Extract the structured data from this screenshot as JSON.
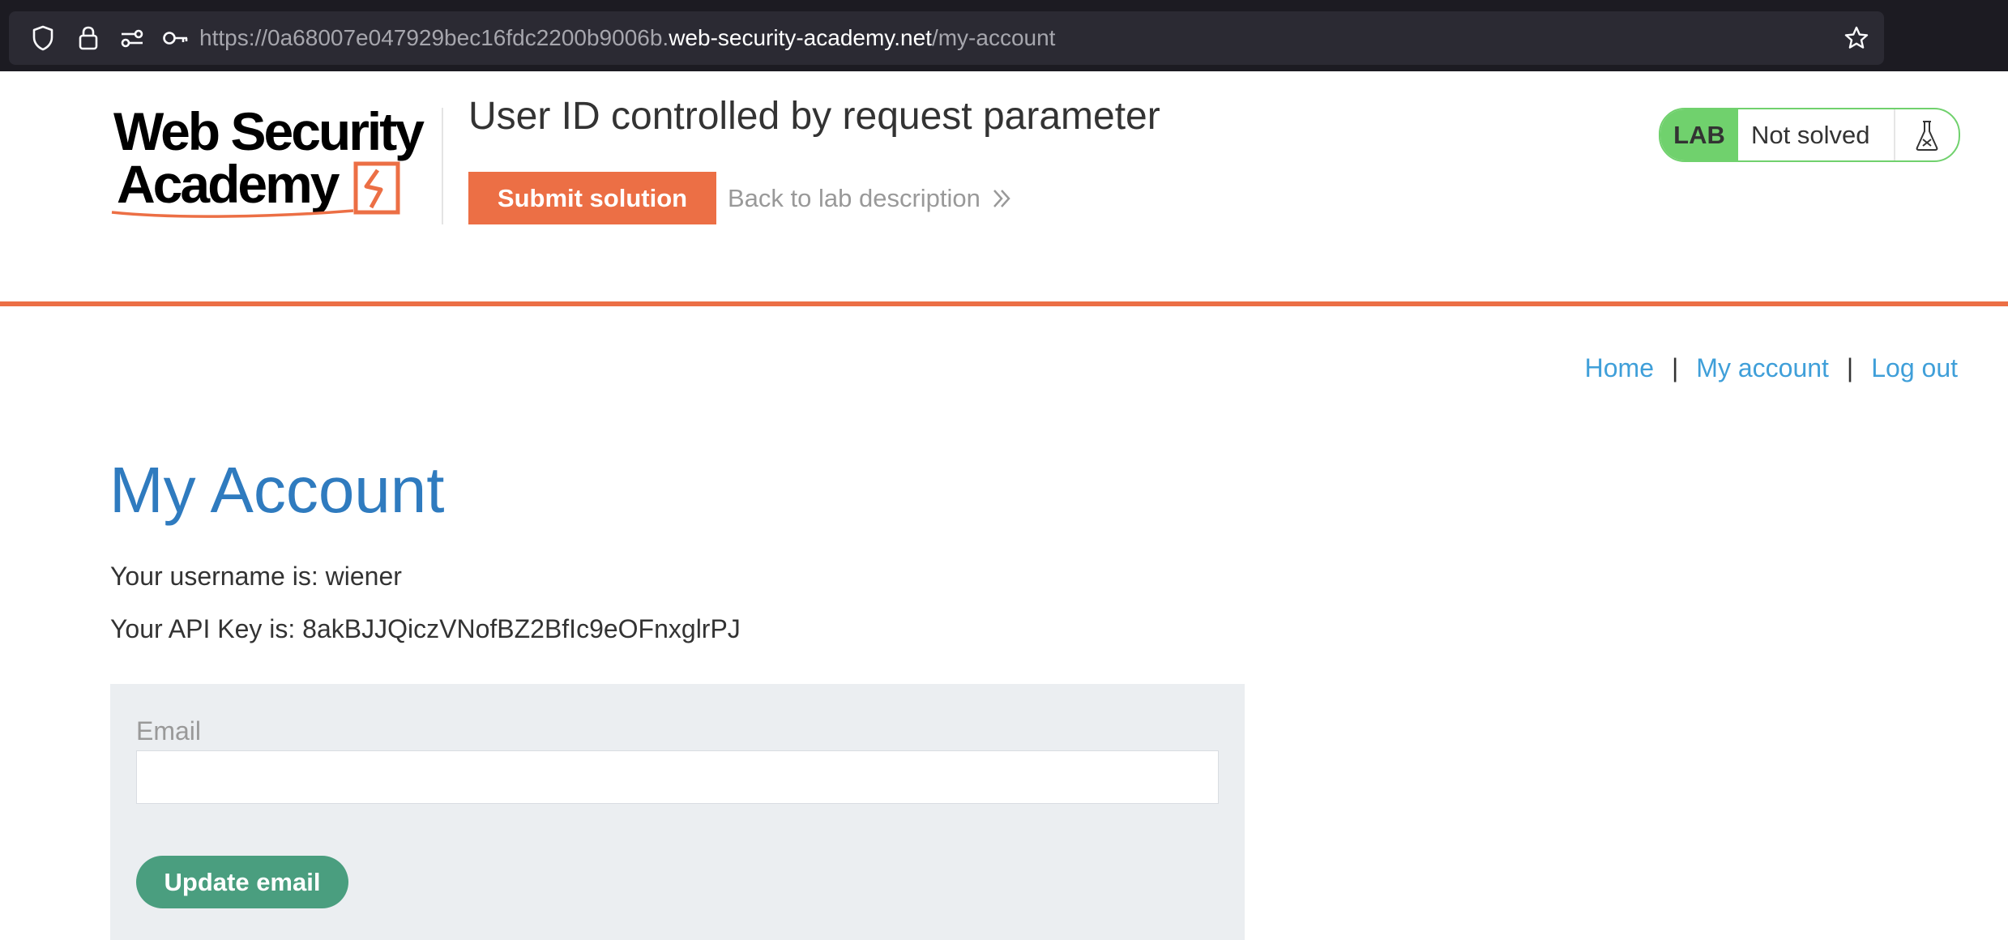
{
  "browser": {
    "url_prefix": "https://0a68007e047929bec16fdc2200b9006b.",
    "url_domain": "web-security-academy.net",
    "url_path": "/my-account"
  },
  "lab_header": {
    "logo_text": "Web Security Academy",
    "title": "User ID controlled by request parameter",
    "submit_label": "Submit solution",
    "back_label": "Back to lab description",
    "status_badge": "LAB",
    "status_text": "Not solved"
  },
  "nav": {
    "home": "Home",
    "separator": "|",
    "my_account": "My account",
    "log_out": "Log out"
  },
  "account": {
    "heading": "My Account",
    "username_line": "Your username is: wiener",
    "api_key_line": "Your API Key is: 8akBJJQiczVNofBZ2BfIc9eOFnxglrPJ",
    "email_label": "Email",
    "email_value": "",
    "update_button": "Update email"
  },
  "colors": {
    "accent_orange": "#ec6f45",
    "lab_green": "#70d16d",
    "link_blue": "#3f9fd9",
    "heading_blue": "#2f7bbf",
    "button_green": "#4a9e7f"
  },
  "icons": [
    "shield-icon",
    "lock-icon",
    "permissions-icon",
    "key-icon",
    "star-icon",
    "chevrons-right-icon",
    "flask-icon"
  ]
}
